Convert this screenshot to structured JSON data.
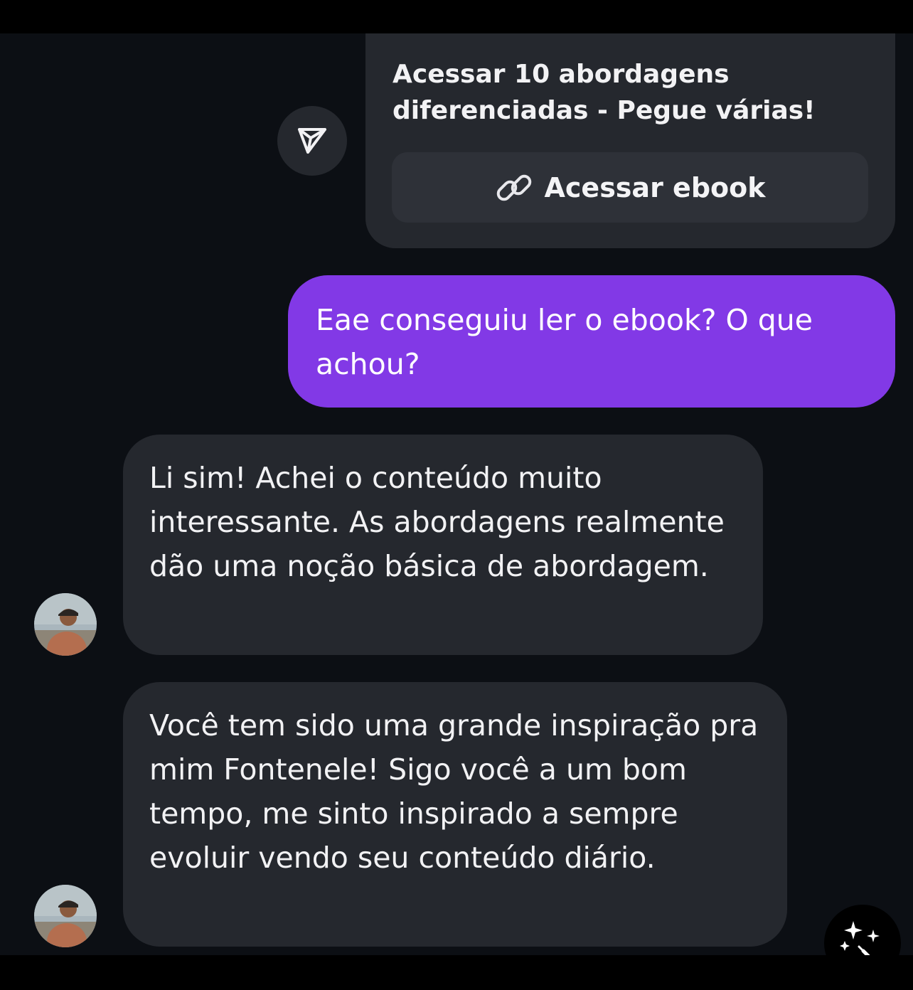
{
  "shared_post": {
    "title": "Acessar 10 abordagens diferenciadas - Pegue várias!",
    "link_label": "Acessar ebook",
    "link_icon": "link-icon",
    "share_icon": "send-icon"
  },
  "messages": [
    {
      "from": "me",
      "text": "Eae conseguiu ler o ebook? O que achou?"
    },
    {
      "from": "them",
      "text": "Li sim! Achei o conteúdo muito interessante. As abordagens realmente dão uma noção básica de abordagem."
    },
    {
      "from": "them",
      "text": "Você tem sido uma grande inspiração pra mim Fontenele! Sigo você a um bom tempo, me sinto inspirado a sempre evoluir vendo seu conteúdo diário."
    }
  ],
  "ai_button_icon": "sparkle-edit-icon",
  "colors": {
    "background": "#0c0f14",
    "received_bubble": "#25282e",
    "sent_bubble": "#8239e6"
  }
}
